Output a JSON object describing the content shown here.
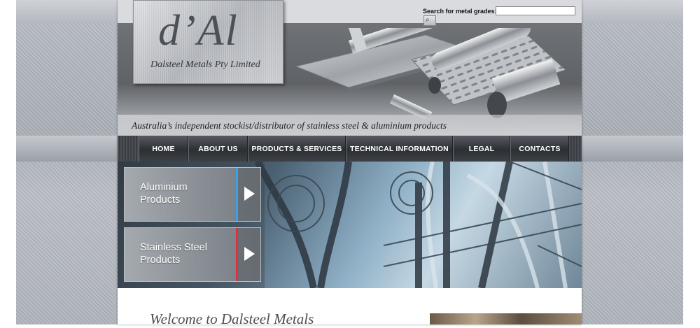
{
  "brand": {
    "logo_mark": "d’Al",
    "company_name": "Dalsteel Metals Pty Limited",
    "tagline": "Australia’s independent stockist/distributor of stainless steel & aluminium products"
  },
  "search": {
    "label": "Search for metal grades:",
    "value": "",
    "button_icon": "magnifier-icon"
  },
  "nav": {
    "items": [
      {
        "label": "HOME"
      },
      {
        "label": "ABOUT US"
      },
      {
        "label": "PRODUCTS & SERVICES"
      },
      {
        "label": "TECHNICAL INFORMATION"
      },
      {
        "label": "LEGAL"
      },
      {
        "label": "CONTACTS"
      }
    ]
  },
  "promos": [
    {
      "label": "Aluminium Products",
      "stripe_color": "#3aa0e8",
      "icon": "play-arrow-icon"
    },
    {
      "label": "Stainless Steel Products",
      "stripe_color": "#e0303a",
      "icon": "play-arrow-icon"
    }
  ],
  "content": {
    "welcome_heading": "Welcome to Dalsteel Metals"
  }
}
